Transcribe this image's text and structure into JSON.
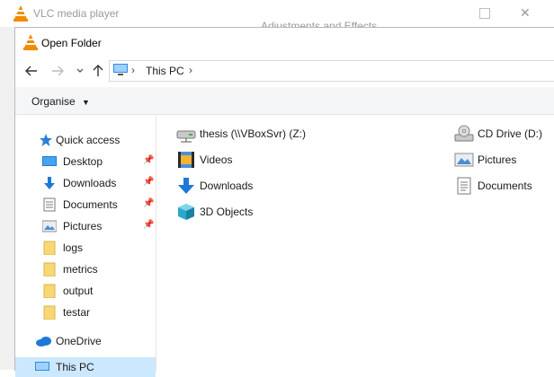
{
  "background_window": {
    "title": "VLC media player",
    "secondary_title": "Adjustments and Effects"
  },
  "dialog": {
    "title": "Open Folder",
    "address": {
      "path": "This PC"
    },
    "toolbar": {
      "organise_label": "Organise"
    }
  },
  "nav_pane": {
    "quick_access": "Quick access",
    "items": [
      {
        "label": "Desktop",
        "icon": "desktop-icon",
        "pinned": true
      },
      {
        "label": "Downloads",
        "icon": "downloads-icon",
        "pinned": true
      },
      {
        "label": "Documents",
        "icon": "documents-icon",
        "pinned": true
      },
      {
        "label": "Pictures",
        "icon": "pictures-icon",
        "pinned": true
      },
      {
        "label": "logs",
        "icon": "folder-icon",
        "pinned": false
      },
      {
        "label": "metrics",
        "icon": "folder-icon",
        "pinned": false
      },
      {
        "label": "output",
        "icon": "folder-icon",
        "pinned": false
      },
      {
        "label": "testar",
        "icon": "folder-icon",
        "pinned": false
      }
    ],
    "onedrive": "OneDrive",
    "this_pc": "This PC"
  },
  "content": {
    "left_column": [
      {
        "label": "thesis (\\\\VBoxSvr) (Z:)",
        "icon": "network-drive-icon"
      },
      {
        "label": "Videos",
        "icon": "videos-icon"
      },
      {
        "label": "Downloads",
        "icon": "downloads-icon"
      },
      {
        "label": "3D Objects",
        "icon": "3d-objects-icon"
      }
    ],
    "right_column": [
      {
        "label": "CD Drive (D:)",
        "icon": "cd-drive-icon"
      },
      {
        "label": "Pictures",
        "icon": "pictures-icon"
      },
      {
        "label": "Documents",
        "icon": "documents-icon"
      }
    ]
  },
  "colors": {
    "selection": "#cce8ff",
    "folder": "#f8d775",
    "accent_blue": "#1e78d6",
    "vlc_orange": "#f08c00"
  }
}
